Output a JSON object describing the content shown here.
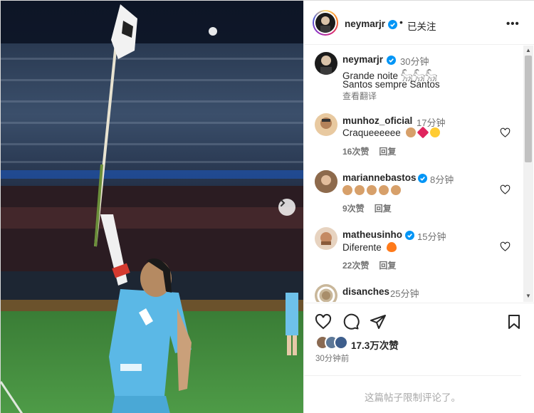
{
  "post": {
    "username": "neymarjr",
    "follow_status": "已关注",
    "more_label": "•••",
    "separator": "•"
  },
  "caption": {
    "username": "neymarjr",
    "time": "30分钟",
    "line1": "Grande noite 𓃵𓃵𓃵",
    "line2": "Santos sempre Santos",
    "translate": "查看翻译"
  },
  "comments": [
    {
      "username": "munhoz_oficial",
      "time": "17分钟",
      "text": "Craqueeeeee",
      "emojis": [
        "clap",
        "heart",
        "heart-eyes"
      ],
      "likes": "16次赞",
      "reply": "回复",
      "verified": false
    },
    {
      "username": "mariannebastos",
      "time": "8分钟",
      "text": "",
      "emojis": [
        "clap",
        "clap",
        "clap",
        "clap",
        "clap"
      ],
      "likes": "9次赞",
      "reply": "回复",
      "verified": true
    },
    {
      "username": "matheusinho",
      "time": "15分钟",
      "text": "Diferente",
      "emojis": [
        "fire"
      ],
      "likes": "22次赞",
      "reply": "回复",
      "verified": true
    },
    {
      "username": "disanches",
      "time": "25分钟",
      "text": "",
      "emojis": [],
      "likes": "",
      "reply": "",
      "verified": false
    }
  ],
  "actions": {
    "likes": "17.3万次赞",
    "posted": "30分钟前"
  },
  "footer": {
    "comments_disabled": "这篇帖子限制评论了。"
  },
  "colors": {
    "verified": "#0095f6",
    "jersey": "#5bb8e6",
    "pitch": "#3f8f3a",
    "heart": "#ed4956"
  }
}
